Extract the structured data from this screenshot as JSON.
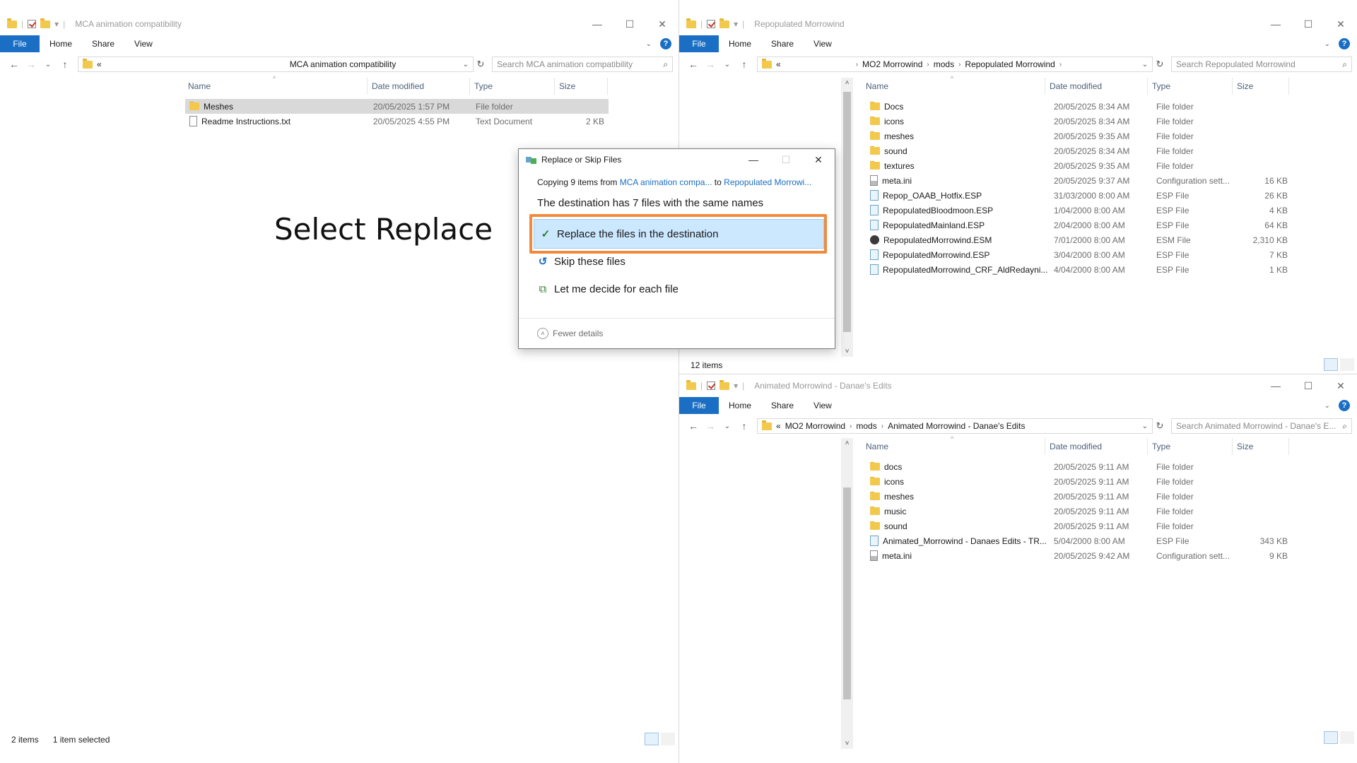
{
  "overlay_text": "Select Replace",
  "left": {
    "title": "MCA animation compatibility",
    "ribbon": {
      "file": "File",
      "home": "Home",
      "share": "Share",
      "view": "View"
    },
    "address": {
      "prefix": "«",
      "path": "MCA animation compatibility"
    },
    "search_placeholder": "Search MCA animation compatibility",
    "columns": {
      "name": "Name",
      "date": "Date modified",
      "type": "Type",
      "size": "Size"
    },
    "rows": [
      {
        "name": "Meshes",
        "date": "20/05/2025 1:57 PM",
        "type": "File folder",
        "size": "",
        "icon": "folder-icon"
      },
      {
        "name": "Readme Instructions.txt",
        "date": "20/05/2025 4:55 PM",
        "type": "Text Document",
        "size": "2 KB",
        "icon": "text-file-icon"
      }
    ],
    "status": {
      "count": "2 items",
      "selected": "1 item selected"
    }
  },
  "top_right": {
    "title": "Repopulated Morrowind",
    "ribbon": {
      "file": "File",
      "home": "Home",
      "share": "Share",
      "view": "View"
    },
    "address": {
      "prefix": "«",
      "crumbs": [
        "MO2 Morrowind",
        "mods",
        "Repopulated Morrowind"
      ]
    },
    "search_placeholder": "Search Repopulated Morrowind",
    "columns": {
      "name": "Name",
      "date": "Date modified",
      "type": "Type",
      "size": "Size"
    },
    "rows": [
      {
        "name": "Docs",
        "date": "20/05/2025 8:34 AM",
        "type": "File folder",
        "size": ""
      },
      {
        "name": "icons",
        "date": "20/05/2025 8:34 AM",
        "type": "File folder",
        "size": ""
      },
      {
        "name": "meshes",
        "date": "20/05/2025 9:35 AM",
        "type": "File folder",
        "size": ""
      },
      {
        "name": "sound",
        "date": "20/05/2025 8:34 AM",
        "type": "File folder",
        "size": ""
      },
      {
        "name": "textures",
        "date": "20/05/2025 9:35 AM",
        "type": "File folder",
        "size": ""
      },
      {
        "name": "meta.ini",
        "date": "20/05/2025 9:37 AM",
        "type": "Configuration sett...",
        "size": "16 KB"
      },
      {
        "name": "Repop_OAAB_Hotfix.ESP",
        "date": "31/03/2000 8:00 AM",
        "type": "ESP File",
        "size": "26 KB"
      },
      {
        "name": "RepopulatedBloodmoon.ESP",
        "date": "1/04/2000 8:00 AM",
        "type": "ESP File",
        "size": "4 KB"
      },
      {
        "name": "RepopulatedMainland.ESP",
        "date": "2/04/2000 8:00 AM",
        "type": "ESP File",
        "size": "64 KB"
      },
      {
        "name": "RepopulatedMorrowind.ESM",
        "date": "7/01/2000 8:00 AM",
        "type": "ESM File",
        "size": "2,310 KB"
      },
      {
        "name": "RepopulatedMorrowind.ESP",
        "date": "3/04/2000 8:00 AM",
        "type": "ESP File",
        "size": "7 KB"
      },
      {
        "name": "RepopulatedMorrowind_CRF_AldRedayni...",
        "date": "4/04/2000 8:00 AM",
        "type": "ESP File",
        "size": "1 KB"
      }
    ],
    "status": {
      "count": "12 items"
    }
  },
  "bottom_right": {
    "title": "Animated Morrowind - Danae's Edits",
    "ribbon": {
      "file": "File",
      "home": "Home",
      "share": "Share",
      "view": "View"
    },
    "address": {
      "prefix": "«",
      "crumbs": [
        "MO2 Morrowind",
        "mods",
        "Animated Morrowind - Danae's Edits"
      ]
    },
    "search_placeholder": "Search Animated Morrowind - Danae's E...",
    "columns": {
      "name": "Name",
      "date": "Date modified",
      "type": "Type",
      "size": "Size"
    },
    "rows": [
      {
        "name": "docs",
        "date": "20/05/2025 9:11 AM",
        "type": "File folder",
        "size": ""
      },
      {
        "name": "icons",
        "date": "20/05/2025 9:11 AM",
        "type": "File folder",
        "size": ""
      },
      {
        "name": "meshes",
        "date": "20/05/2025 9:11 AM",
        "type": "File folder",
        "size": ""
      },
      {
        "name": "music",
        "date": "20/05/2025 9:11 AM",
        "type": "File folder",
        "size": ""
      },
      {
        "name": "sound",
        "date": "20/05/2025 9:11 AM",
        "type": "File folder",
        "size": ""
      },
      {
        "name": "Animated_Morrowind - Danaes Edits - TR...",
        "date": "5/04/2000 8:00 AM",
        "type": "ESP File",
        "size": "343 KB"
      },
      {
        "name": "meta.ini",
        "date": "20/05/2025 9:42 AM",
        "type": "Configuration sett...",
        "size": "9 KB"
      }
    ]
  },
  "dialog": {
    "title": "Replace or Skip Files",
    "copy_prefix": "Copying 9 items from",
    "copy_source": "MCA animation compa...",
    "copy_to": "to",
    "copy_dest": "Repopulated Morrowi...",
    "destination_text": "The destination has 7 files with the same names",
    "options": {
      "replace": "Replace the files in the destination",
      "skip": "Skip these files",
      "decide": "Let me decide for each file"
    },
    "fewer_details": "Fewer details"
  },
  "colors": {
    "accent": "#1a6fc4",
    "highlight_border": "#f28a3d",
    "selected_option": "#cce8ff"
  }
}
